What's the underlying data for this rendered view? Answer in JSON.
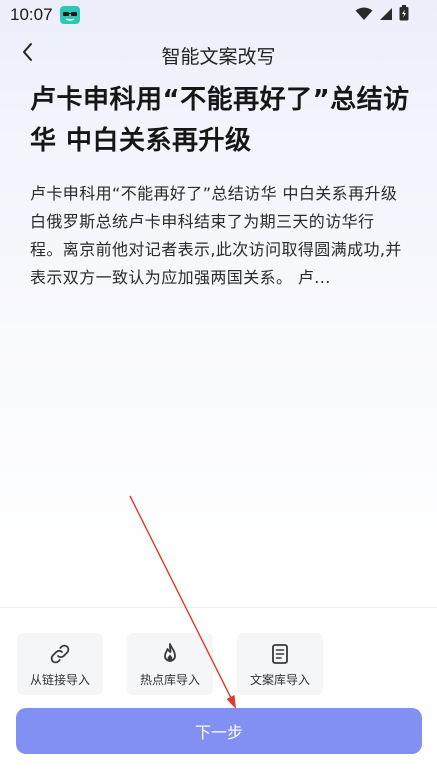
{
  "status_bar": {
    "time": "10:07",
    "icons": [
      "app-badge-icon",
      "wifi-icon",
      "signal-icon",
      "battery-icon"
    ]
  },
  "header": {
    "title": "智能文案改写",
    "back_icon": "chevron-left-icon"
  },
  "article": {
    "title": "卢卡申科用“不能再好了”总结访华 中白关系再升级",
    "body": "卢卡申科用“不能再好了”总结访华 中白关系再升级 白俄罗斯总统卢卡申科结束了为期三天的访华行程。离京前他对记者表示,此次访问取得圆满成功,并表示双方一致认为应加强两国关系。 卢..."
  },
  "import_options": [
    {
      "label": "从链接导入",
      "icon": "link-icon"
    },
    {
      "label": "热点库导入",
      "icon": "flame-icon"
    },
    {
      "label": "文案库导入",
      "icon": "document-icon"
    }
  ],
  "next_button": {
    "label": "下一步"
  },
  "colors": {
    "accent": "#8290f4",
    "annotation_arrow": "#e03a2f"
  }
}
